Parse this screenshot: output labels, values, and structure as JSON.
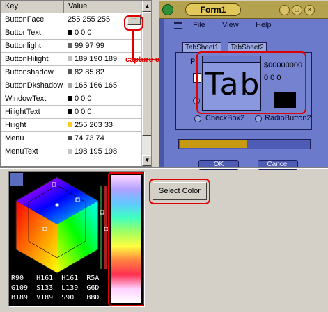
{
  "grid": {
    "headers": [
      "Key",
      "Value"
    ],
    "rows": [
      {
        "key": "ButtonFace",
        "value": "255 255 255",
        "swatch": "",
        "editing": true
      },
      {
        "key": "ButtonText",
        "value": "0 0 0",
        "swatch": "#000000"
      },
      {
        "key": "Buttonlight",
        "value": "99 97 99",
        "swatch": "#636163"
      },
      {
        "key": "ButtonHilight",
        "value": "189 190 189",
        "swatch": "#bdbebd"
      },
      {
        "key": "Buttonshadow",
        "value": "82 85 82",
        "swatch": "#525552"
      },
      {
        "key": "ButtonDkshadow",
        "value": "165 166 165",
        "swatch": "#a5a6a5"
      },
      {
        "key": "WindowText",
        "value": "0 0 0",
        "swatch": "#000000"
      },
      {
        "key": "HilightText",
        "value": "0 0 0",
        "swatch": "#000000"
      },
      {
        "key": "Hilight",
        "value": "255 203 33",
        "swatch": "#ffcb21"
      },
      {
        "key": "Menu",
        "value": "74 73 74",
        "swatch": "#4a494a"
      },
      {
        "key": "MenuText",
        "value": "198 195 198",
        "swatch": "#c6c3c6"
      }
    ],
    "ellipsis_label": "...",
    "scroll_up_glyph": "▲",
    "scroll_down_glyph": "▼"
  },
  "annotation": {
    "capture_label": "capture color"
  },
  "form": {
    "title": "Form1",
    "menu": [
      "File",
      "View",
      "Help"
    ],
    "tabs": [
      "TabSheet1",
      "TabSheet2"
    ],
    "checkbox_label": "CheckBox2",
    "radio_label": "RadioButton2",
    "ok_label": "OK",
    "cancel_label": "Cancel",
    "progress": 0.52
  },
  "capture_popup": {
    "zoom_text": "Tab",
    "hex_value": "$00000000",
    "rgb_value": "0 0 0",
    "color": "#000000"
  },
  "picker": {
    "readout": [
      "R90   H161  H161  R5A",
      "G109  S133  L139  G6D",
      "B189  V189  S90   BBD"
    ],
    "current_color": "#5a6dbd"
  },
  "select_color_label": "Select Color",
  "colors": {
    "accent_annotation": "#e00000",
    "window_face": "#6b7acb",
    "title_bar": "#b5a24f"
  }
}
